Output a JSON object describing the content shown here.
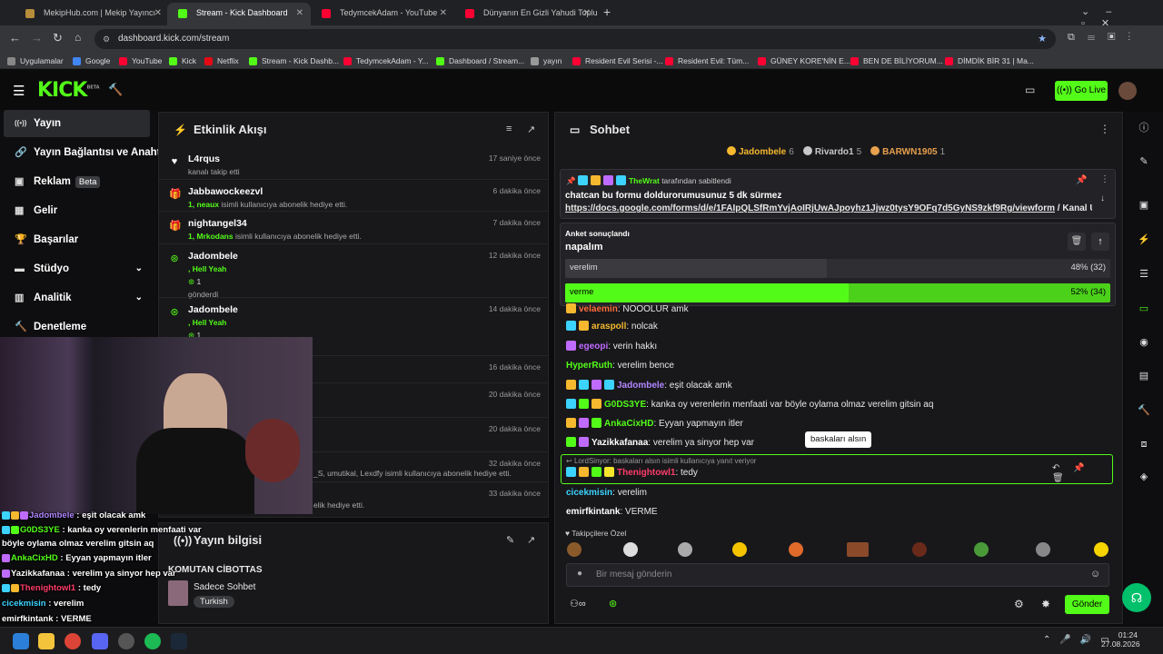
{
  "browser": {
    "tabs": [
      {
        "title": "MekipHub.com | Mekip Yayıncı",
        "color": "#b78c3a"
      },
      {
        "title": "Stream - Kick Dashboard",
        "color": "#53fc18"
      },
      {
        "title": "TedymcekAdam - YouTube",
        "color": "#ff0033"
      },
      {
        "title": "Dünyanın En Gizli Yahudi Toplul",
        "color": "#ff0033"
      }
    ],
    "url": "dashboard.kick.com/stream",
    "bookmarks": [
      {
        "label": "Uygulamalar",
        "color": "#888"
      },
      {
        "label": "Google",
        "color": "#4285f4"
      },
      {
        "label": "YouTube",
        "color": "#ff0033"
      },
      {
        "label": "Kick",
        "color": "#53fc18"
      },
      {
        "label": "Netflix",
        "color": "#e50914"
      },
      {
        "label": "Stream - Kick Dashb...",
        "color": "#53fc18"
      },
      {
        "label": "TedymcekAdam - Y...",
        "color": "#ff0033"
      },
      {
        "label": "Dashboard / Stream...",
        "color": "#53fc18"
      },
      {
        "label": "yayın",
        "color": "#999"
      },
      {
        "label": "Resident Evil Serisi -...",
        "color": "#ff0033"
      },
      {
        "label": "Resident Evil: Tüm...",
        "color": "#ff0033"
      },
      {
        "label": "GÜNEY KORE'NİN E...",
        "color": "#ff0033"
      },
      {
        "label": "BEN DE BİLİYORUM...",
        "color": "#ff0033"
      },
      {
        "label": "DİMDİK BİR 31 | Ma...",
        "color": "#ff0033"
      }
    ]
  },
  "kick": {
    "logo": "KICK",
    "beta": "BETA",
    "go_live": "Go Live"
  },
  "nav": {
    "items": [
      {
        "label": "Yayın",
        "icon": "stream-icon",
        "glyph": "((•))"
      },
      {
        "label": "Yayın Bağlantısı ve Anahtar",
        "icon": "link-icon",
        "glyph": "🔗"
      },
      {
        "label": "Reklam",
        "icon": "ad-icon",
        "glyph": "▣"
      },
      {
        "label": "Gelir",
        "icon": "revenue-icon",
        "glyph": "▦"
      },
      {
        "label": "Başarılar",
        "icon": "trophy-icon",
        "glyph": "🏆"
      },
      {
        "label": "Stüdyo",
        "icon": "studio-icon",
        "glyph": "▬"
      },
      {
        "label": "Analitik",
        "icon": "analytics-icon",
        "glyph": "▥"
      },
      {
        "label": "Denetleme",
        "icon": "moderation-icon",
        "glyph": "🔨"
      }
    ],
    "reklam_badge": "Beta"
  },
  "activity": {
    "title": "Etkinlik Akışı",
    "events": [
      {
        "name": "L4rqus",
        "desc": "kanalı takip etti",
        "time": "17 saniye önce",
        "icon": "heart-icon"
      },
      {
        "name": "Jabbawockeezvl",
        "gift_user": "1, neaux",
        "desc": " isimli kullanıcıya abonelik hediye etti.",
        "time": "6 dakika önce",
        "icon": "gift-icon"
      },
      {
        "name": "nightangel34",
        "gift_user": "1, Mrkodans",
        "desc": " isimli kullanıcıya abonelik hediye etti.",
        "time": "7 dakika önce",
        "icon": "gift-icon"
      },
      {
        "name": "Jadombele",
        "line2": ", Hell Yeah",
        "line3": "1",
        "line4": "gönderdi",
        "time": "12 dakika önce",
        "icon": "kick-coin-icon"
      },
      {
        "name": "Jadombele",
        "line2": ", Hell Yeah",
        "line3": "1",
        "time": "14 dakika önce",
        "icon": "kick-coin-icon"
      }
    ],
    "hidden_times": [
      "16 dakika önce",
      "20 dakika önce",
      "20 dakika önce",
      "32 dakika önce",
      "33 dakika önce"
    ],
    "partial_line1": "_S, umutikal, Lexdfy isimli kullanıcıya abonelik hediye etti.",
    "partial_line2": "elik hediye etti."
  },
  "stream_info": {
    "title": "Yayın bilgisi",
    "stream_title": "KOMUTAN CİBOTTAS",
    "category": "Sadece Sohbet",
    "tag": "Turkish"
  },
  "chat": {
    "title": "Sohbet",
    "leaderboard": [
      {
        "name": "Jadombele",
        "count": "6",
        "color": "#f5b82e"
      },
      {
        "name": "Rivardo1",
        "count": "5",
        "color": "#c8c8c8"
      },
      {
        "name": "BARWN1905",
        "count": "1",
        "color": "#e8a04c"
      }
    ],
    "pinned": {
      "by_user": "TheWrat",
      "by_text": " tarafından sabitlendi",
      "line1": "chatcan bu formu doldurorumusunuz 5 dk sürmez",
      "line2_link": "https://docs.google.com/forms/d/e/1FAIpQLSfRmYvjAoIRjUwAJpoyhz1Jjwz0tysY9OFq7d5GyNS9zkf9Rg/viewform",
      "line2_rest": " / Kanal Urls..."
    },
    "poll": {
      "label": "Anket sonuçlandı",
      "question": "napalım",
      "options": [
        {
          "label": "verelim",
          "result": "48% (32)",
          "pct": 48
        },
        {
          "label": "verme",
          "result": "52% (34)",
          "pct": 52
        }
      ]
    },
    "messages": [
      {
        "user": "velaemin",
        "text": ": NOOOLUR amk",
        "color": "#ff6f3c"
      },
      {
        "user": "araspoll",
        "text": ": nolcak",
        "color": "#f5b82e"
      },
      {
        "user": "egeopi",
        "text": ": verin hakkı",
        "color": "#c06bff"
      },
      {
        "user": "HyperRuth",
        "text": ": verelim bence",
        "color": "#53fc18"
      },
      {
        "user": "Jadombele",
        "text": ": eşit olacak amk",
        "color": "#b286ff"
      },
      {
        "user": "G0DS3YE",
        "text": ": kanka oy verenlerin menfaati var böyle oylama olmaz verelim gitsin aq",
        "color": "#53fc18"
      },
      {
        "user": "AnkaCixHD",
        "text": ": Eyyan yapmayın itler",
        "color": "#53fc18"
      },
      {
        "user": "Yazikkafanaa",
        "text": ": verelim ya sinyor hep var",
        "color": "#ffffff"
      },
      {
        "user": "Thenightowl1",
        "text": ": tedy",
        "color": "#ff3c6a"
      },
      {
        "user": "cicekmisin",
        "text": ": verelim",
        "color": "#3cd3ff"
      },
      {
        "user": "emirfkintank",
        "text": ": VERME",
        "color": "#ffffff"
      }
    ],
    "reply_ref": "LordSinyor: baskaları alsın isimli kullanıcıya yanıt veriyor",
    "tooltip": "baskaları alsın",
    "emote_section": "Takipçilere Özel",
    "input_placeholder": "Bir mesaj gönderin",
    "send_label": "Gönder"
  },
  "overlay_chat": [
    {
      "user": "Jadombele",
      "text": " : eşit olacak amk",
      "color": "#b286ff"
    },
    {
      "user": "G0DS3YE",
      "text": " : kanka oy verenlerin menfaati var",
      "color": "#53fc18"
    },
    {
      "user": "",
      "text": "böyle oylama olmaz verelim gitsin aq",
      "color": "#ffffff"
    },
    {
      "user": "AnkaCixHD",
      "text": " : Eyyan yapmayın itler",
      "color": "#53fc18"
    },
    {
      "user": "Yazikkafanaa",
      "text": " : verelim ya sinyor hep var",
      "color": "#ffffff"
    },
    {
      "user": "Thenightowl1",
      "text": " : tedy",
      "color": "#ff3c6a"
    },
    {
      "user": "cicekmisin",
      "text": " : verelim",
      "color": "#3cd3ff"
    },
    {
      "user": "emirfkintank",
      "text": " : VERME",
      "color": "#ffffff"
    }
  ],
  "taskbar": {
    "time": "01:24",
    "date": "27.08.2026"
  }
}
